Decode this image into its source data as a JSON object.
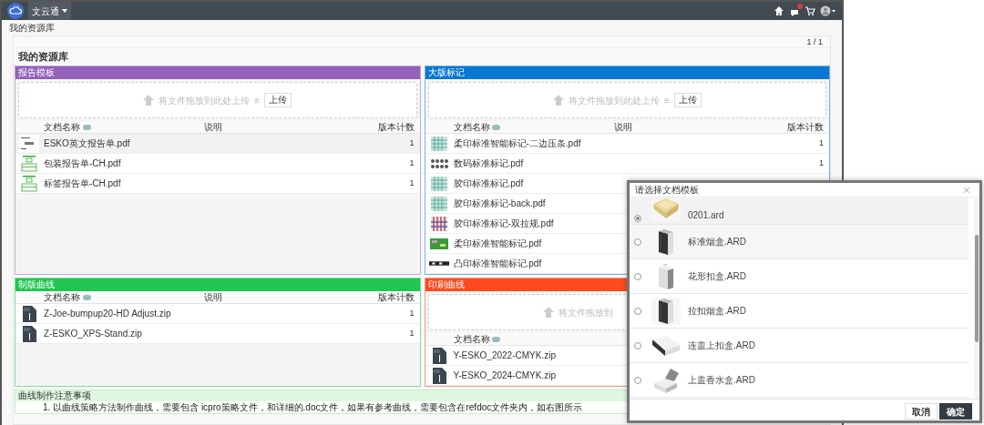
{
  "navbar": {
    "brand": "文云通",
    "has_notification": true
  },
  "breadcrumb": "我的资源库",
  "pager": "1 / 1",
  "heading": "我的资源库",
  "panel_rows": [
    [
      {
        "title": "报告模板",
        "color": "#9461bb",
        "dropzone": {
          "prompt": "将文件拖放到此处上传",
          "separator": "≡",
          "button": "上传"
        },
        "columns": [
          "文档名称",
          "说明",
          "版本计数"
        ],
        "files": [
          {
            "kind": "report",
            "name": "ESKO英文报告单.pdf",
            "count": "1",
            "selected": true
          },
          {
            "kind": "chart",
            "name": "包装报告单-CH.pdf",
            "count": "1",
            "selected": false
          },
          {
            "kind": "chart",
            "name": "标签报告单-CH.pdf",
            "count": "1",
            "selected": false
          }
        ]
      },
      {
        "title": "大版标记",
        "color": "#0a78d2",
        "dropzone": {
          "prompt": "将文件拖放到此处上传",
          "separator": "≡",
          "button": "上传"
        },
        "columns": [
          "文档名称",
          "说明",
          "版本计数"
        ],
        "files": [
          {
            "kind": "grid",
            "name": "柔印标准智能标记-二边压条.pdf",
            "count": "1",
            "selected": false
          },
          {
            "kind": "dots",
            "name": "数码标准标记.pdf",
            "count": "1",
            "selected": false
          },
          {
            "kind": "grid",
            "name": "胶印标准标记.pdf",
            "selected": false
          },
          {
            "kind": "grid",
            "name": "胶印标准标记-back.pdf",
            "selected": false
          },
          {
            "kind": "color",
            "name": "胶印标准标记-双拉规.pdf",
            "selected": false
          },
          {
            "kind": "green",
            "name": "柔印标准智能标记.pdf",
            "selected": false
          },
          {
            "kind": "strip",
            "name": "凸印标准智能标记.pdf",
            "selected": false
          }
        ]
      }
    ],
    [
      {
        "title": "制版曲线",
        "color": "#21c551",
        "columns": [
          "文档名称",
          "说明",
          "版本计数"
        ],
        "files": [
          {
            "kind": "zip",
            "name": "Z-Joe-bumpup20-HD Adjust.zip",
            "count": "1",
            "selected": false
          },
          {
            "kind": "zip",
            "name": "Z-ESKO_XPS-Stand.zip",
            "count": "1",
            "selected": false
          }
        ]
      },
      {
        "title": "印刷曲线",
        "color": "#fd4b1f",
        "dropzone": {
          "prompt": "将文件拖放到"
        },
        "columns": [
          "文档名称"
        ],
        "files": [
          {
            "kind": "zip",
            "name": "Y-ESKO_2022-CMYK.zip",
            "selected": false
          },
          {
            "kind": "zip",
            "name": "Y-ESKO_2024-CMYK.zip",
            "selected": false
          }
        ]
      }
    ]
  ],
  "notice": {
    "title": "曲线制作注意事项",
    "items": [
      "1. 以曲线策略方法制作曲线，需要包含 icpro策略文件，和详细的.doc文件，如果有参考曲线，需要包含在refdoc文件夹内，如右图所示"
    ]
  },
  "modal": {
    "title": "请选择文档模板",
    "close": "×",
    "items": [
      {
        "name": "0201.ard",
        "kind": "tray",
        "selected": true
      },
      {
        "name": "标准烟盒.ARD",
        "kind": "dark",
        "selected": false
      },
      {
        "name": "花形扣盒.ARD",
        "kind": "light",
        "selected": false
      },
      {
        "name": "拉扣烟盒.ARD",
        "kind": "dark",
        "selected": false
      },
      {
        "name": "连盖上扣盒.ARD",
        "kind": "flat",
        "selected": false
      },
      {
        "name": "上盖香水盒.ARD",
        "kind": "open",
        "selected": false
      }
    ],
    "buttons": [
      {
        "label": "取消",
        "kind": "secondary"
      },
      {
        "label": "确定",
        "kind": "primary"
      }
    ]
  }
}
